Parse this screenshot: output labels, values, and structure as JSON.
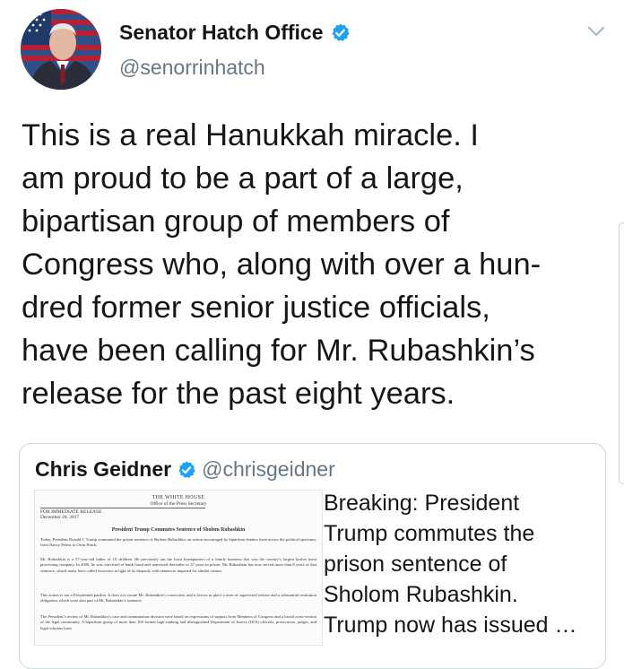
{
  "tweet": {
    "author_name": "Senator Hatch Office",
    "author_handle": "@senorrinhatch",
    "text_lines": [
      "This is a real Hanukkah miracle. I",
      "am proud to be a part of a large,",
      "bipartisan group of members of",
      "Congress who, along with over a hun-",
      "dred former senior justice officials,",
      "have been calling for Mr. Rubashkin’s",
      "release for the past eight years."
    ]
  },
  "quoted_tweet": {
    "author_name": "Chris Geidner",
    "author_handle": "@chrisgeidner",
    "text_lines": [
      "Breaking: President",
      "Trump commutes the",
      "prison sentence of",
      "Sholom Rubashkin.",
      "Trump now has issued …"
    ],
    "document": {
      "header": "THE WHITE HOUSE",
      "subheader": "Office of the Press Secretary",
      "release": "FOR IMMEDIATE RELEASE",
      "date": "December 20, 2017",
      "title": "President Trump Commutes Sentence of Sholom Rubashkin",
      "paragraphs": [
        "Today, President Donald J. Trump commuted the prison sentence of Sholom Rubashkin, an action encouraged by bipartisan leaders from across the political spectrum, from Nancy Pelosi to Orrin Hatch.",
        "Mr. Rubashkin is a 57-year-old father of 10 children. He previously ran the Iowa headquarters of a family business that was the country’s largest kosher meat processing company. In 2009, he was convicted of bank fraud and sentenced thereafter to 27 years in prison. Mr. Rubashkin has now served more than 8 years of that sentence, which many have called excessive in light of its disparity with sentences imposed for similar crimes.",
        "This action is not a Presidential pardon. It does not vacate Mr. Rubashkin’s conviction, and it leaves in place a term of supervised release and a substantial restitution obligation, which were also part of Mr. Rubashkin’s sentence.",
        "The President’s review of Mr. Rubashkin’s case and commutation decision were based on expressions of support from Members of Congress and a broad cross-section of the legal community. A bipartisan group of more than 100 former high-ranking and distinguished Department of Justice (DOJ) officials, prosecutors, judges, and legal scholars have"
      ]
    }
  },
  "icons": {
    "verified": "verified-badge-icon",
    "menu": "chevron-down-icon"
  },
  "colors": {
    "verified_blue": "#1da1f2",
    "text_primary": "#14171a",
    "text_secondary": "#657786",
    "border": "#ccd6dd"
  }
}
